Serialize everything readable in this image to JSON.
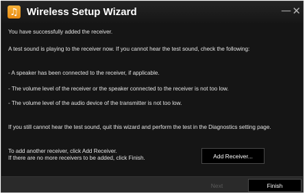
{
  "window": {
    "title": "Wireless Setup Wizard",
    "app_icon_glyph": "♫",
    "minimize_glyph": "—",
    "close_glyph": "✕"
  },
  "content": {
    "line1": "You have successfully added the receiver.",
    "line2": "A test sound is playing to the receiver now. If you cannot hear the test sound, check the following:",
    "bullet1": "- A speaker has been connected to the receiver, if applicable.",
    "bullet2": "- The volume level of the receiver or the speaker connected to the receiver is not too low.",
    "bullet3": "- The volume level of the audio device of the transmitter is not too low.",
    "para": "If you still cannot hear the test sound, quit this wizard and perform the test in the Diagnostics setting page.",
    "footer_line1": "To add another receiver, click Add Receiver.",
    "footer_line2": "If there are no more receivers to be added, click Finish."
  },
  "buttons": {
    "add_receiver": "Add Receiver...",
    "next": "Next",
    "finish": "Finish"
  },
  "colors": {
    "background": "#151515",
    "text": "#e6e6e6",
    "accent": "#f7a52a",
    "disabled": "#5c5c5c"
  }
}
